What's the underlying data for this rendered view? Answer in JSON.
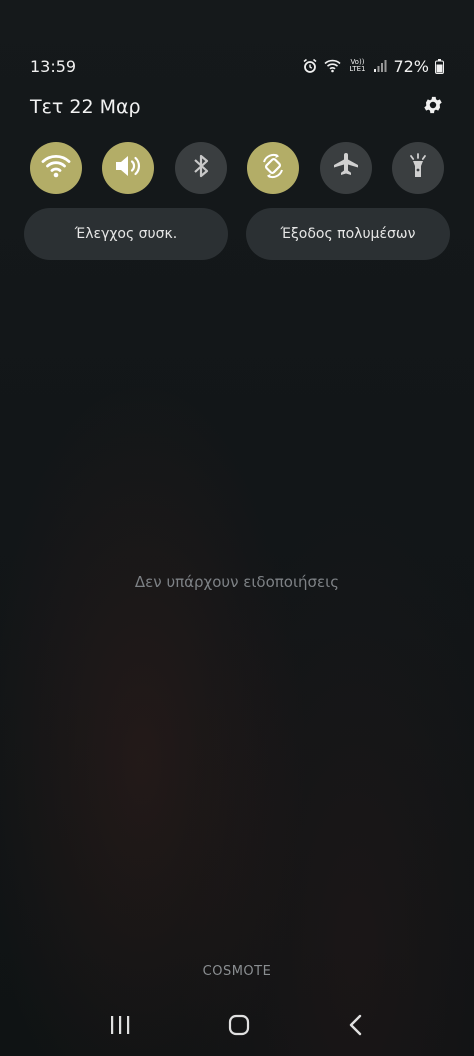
{
  "status_bar": {
    "time": "13:59",
    "volte_label": "Vo)) LTE1",
    "battery_percent": "72%",
    "icons": [
      "alarm-icon",
      "wifi-icon",
      "volte-icon",
      "signal-icon",
      "battery-icon"
    ]
  },
  "header": {
    "date": "Τετ 22 Μαρ",
    "settings_icon": "gear-icon"
  },
  "quick_toggles": [
    {
      "name": "wifi",
      "icon": "wifi-icon",
      "state": "on"
    },
    {
      "name": "sound",
      "icon": "speaker-icon",
      "state": "on"
    },
    {
      "name": "bluetooth",
      "icon": "bluetooth-icon",
      "state": "off"
    },
    {
      "name": "auto-rotate",
      "icon": "rotate-icon",
      "state": "on"
    },
    {
      "name": "airplane",
      "icon": "airplane-icon",
      "state": "off"
    },
    {
      "name": "flashlight",
      "icon": "flashlight-icon",
      "state": "off"
    }
  ],
  "buttons": {
    "device_control": "Έλεγχος συσκ.",
    "media_output": "Έξοδος πολυμέσων"
  },
  "notifications": {
    "empty_text": "Δεν υπάρχουν ειδοποιήσεις"
  },
  "carrier": "COSMOTE",
  "navbar": {
    "icons": [
      "recents-icon",
      "home-icon",
      "back-icon"
    ]
  },
  "colors": {
    "toggle_on": "#b3ad67",
    "toggle_off": "#3a3e40",
    "background": "#131719"
  }
}
